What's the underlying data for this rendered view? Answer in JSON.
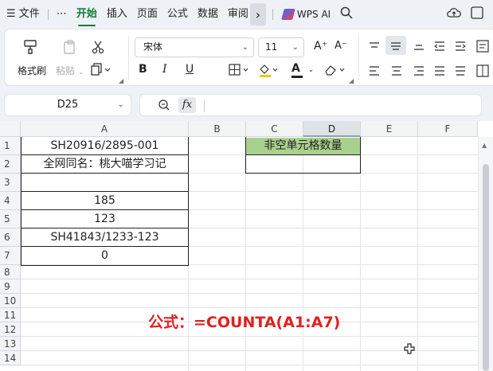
{
  "menubar": {
    "hamburger": "☰",
    "file": "文件",
    "more_dots": "⋯",
    "tabs": [
      "开始",
      "插入",
      "页面",
      "公式",
      "数据",
      "审阅"
    ],
    "active_tab": "开始",
    "more_arrow": "›",
    "wps_ai": "WPS AI"
  },
  "ribbon": {
    "format_painter": "格式刷",
    "paste": "粘贴",
    "font_name": "宋体",
    "font_size": "11",
    "bold": "B",
    "italic": "I",
    "underline": "U",
    "font_color_letter": "A",
    "grow_font": "A⁺",
    "shrink_font": "A⁻"
  },
  "formula_bar": {
    "name_box": "D25",
    "fx": "fx",
    "content": ""
  },
  "sheet": {
    "columns": [
      "A",
      "B",
      "C",
      "D",
      "E",
      "F"
    ],
    "selected_column": "D",
    "rows": [
      "1",
      "2",
      "3",
      "4",
      "5",
      "6",
      "7",
      "8",
      "9",
      "10",
      "11",
      "12",
      "13",
      "14"
    ],
    "cells": {
      "A1": "SH20916/2895-001",
      "A2": "全网同名：桃大喵学习记",
      "A3": "",
      "A4": "185",
      "A5": "123",
      "A6": "SH41843/1233-123",
      "A7": "0",
      "C1": "非空单元格数量",
      "C2": ""
    },
    "header_fill": "#a9d18e",
    "formula_note": "公式：=COUNTA(A1:A7)",
    "formula_note_color": "#e02020"
  }
}
